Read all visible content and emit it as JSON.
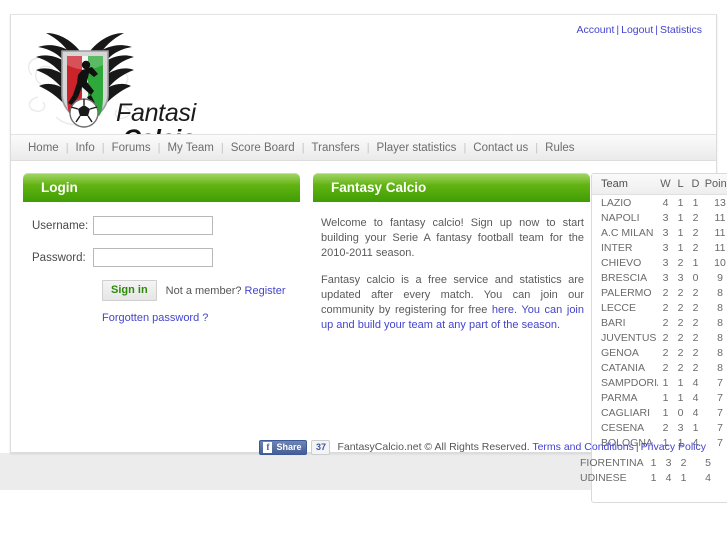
{
  "top_links": [
    {
      "label": "Account"
    },
    {
      "label": "Logout"
    },
    {
      "label": "Statistics"
    }
  ],
  "top_link_separator": "|",
  "logo": {
    "line1": "Fantasi",
    "line2": "Calcio",
    "colors": {
      "crest_red": "#cc2229",
      "crest_green": "#2ea83a",
      "crest_white": "#f2f2f2",
      "wing_black": "#1a1a1a"
    }
  },
  "nav": {
    "separator": "|",
    "items": [
      {
        "label": "Home"
      },
      {
        "label": "Info"
      },
      {
        "label": "Forums"
      },
      {
        "label": "My Team"
      },
      {
        "label": "Score Board"
      },
      {
        "label": "Transfers"
      },
      {
        "label": "Player statistics"
      },
      {
        "label": "Contact us"
      },
      {
        "label": "Rules"
      }
    ]
  },
  "login": {
    "title": "Login",
    "username_label": "Username:",
    "username_value": "",
    "username_placeholder": "",
    "password_label": "Password:",
    "password_value": "",
    "password_placeholder": "",
    "signin_label": "Sign in",
    "member_prompt": "Not a member?",
    "register_label": "Register",
    "forgotten_label": "Forgotten password ?"
  },
  "content": {
    "title": "Fantasy Calcio",
    "paragraph1": "Welcome to fantasy calcio! Sign up now to start building your Serie A fantasy football team for the 2010-2011 season.",
    "paragraph2_plain": "Fantasy calcio is a free service and statistics are updated after every match. You can join our community by registering for free ",
    "paragraph2_link": "here. You can join up and build your team at any part of the season."
  },
  "standings": {
    "columns": [
      "Team",
      "W",
      "L",
      "D",
      "Points"
    ],
    "rows": [
      {
        "team": "LAZIO",
        "w": "4",
        "l": "1",
        "d": "1",
        "points": "13"
      },
      {
        "team": "NAPOLI",
        "w": "3",
        "l": "1",
        "d": "2",
        "points": "11"
      },
      {
        "team": "A.C MILAN",
        "w": "3",
        "l": "1",
        "d": "2",
        "points": "11"
      },
      {
        "team": "INTER",
        "w": "3",
        "l": "1",
        "d": "2",
        "points": "11"
      },
      {
        "team": "CHIEVO",
        "w": "3",
        "l": "2",
        "d": "1",
        "points": "10"
      },
      {
        "team": "BRESCIA",
        "w": "3",
        "l": "3",
        "d": "0",
        "points": "9"
      },
      {
        "team": "PALERMO",
        "w": "2",
        "l": "2",
        "d": "2",
        "points": "8"
      },
      {
        "team": "LECCE",
        "w": "2",
        "l": "2",
        "d": "2",
        "points": "8"
      },
      {
        "team": "BARI",
        "w": "2",
        "l": "2",
        "d": "2",
        "points": "8"
      },
      {
        "team": "JUVENTUS",
        "w": "2",
        "l": "2",
        "d": "2",
        "points": "8"
      },
      {
        "team": "GENOA",
        "w": "2",
        "l": "2",
        "d": "2",
        "points": "8"
      },
      {
        "team": "CATANIA",
        "w": "2",
        "l": "2",
        "d": "2",
        "points": "8"
      },
      {
        "team": "SAMPDORIA",
        "w": "1",
        "l": "1",
        "d": "4",
        "points": "7"
      },
      {
        "team": "PARMA",
        "w": "1",
        "l": "1",
        "d": "4",
        "points": "7"
      },
      {
        "team": "CAGLIARI",
        "w": "1",
        "l": "0",
        "d": "4",
        "points": "7"
      },
      {
        "team": "CESENA",
        "w": "2",
        "l": "3",
        "d": "1",
        "points": "7"
      },
      {
        "team": "BOLOGNA",
        "w": "1",
        "l": "1",
        "d": "4",
        "points": "7"
      }
    ],
    "overflow_rows": [
      {
        "team": "FIORENTINA",
        "w": "1",
        "l": "3",
        "d": "2",
        "points": "5"
      },
      {
        "team": "UDINESE",
        "w": "1",
        "l": "4",
        "d": "1",
        "points": "4"
      }
    ]
  },
  "footer": {
    "share_label": "Share",
    "share_icon_letter": "f",
    "share_count": "37",
    "copyright": "FantasyCalcio.net © All Rights Reserved.",
    "terms_label": "Terms and Conditions",
    "separator": "|",
    "privacy_label": "Privacy Policy"
  }
}
